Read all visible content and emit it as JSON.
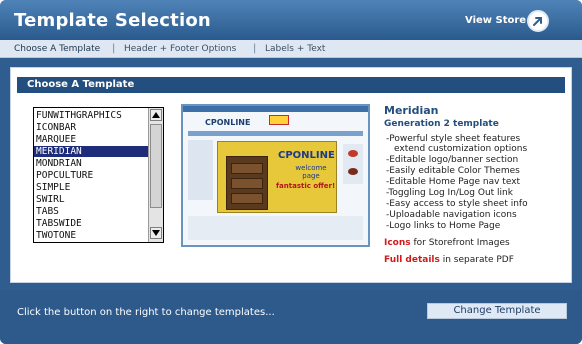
{
  "header": {
    "title": "Template Selection",
    "view_store_label": "View Store",
    "view_store_icon": "arrow-circle-icon"
  },
  "tabs": [
    {
      "label": "Choose A Template",
      "active": true
    },
    {
      "label": "Header + Footer Options",
      "active": false
    },
    {
      "label": "Labels + Text",
      "active": false
    }
  ],
  "tab_separator": "|",
  "section": {
    "title": "Choose A Template"
  },
  "template_list": {
    "items": [
      "FUNWITHGRAPHICS",
      "ICONBAR",
      "MARQUEE",
      "MERIDIAN",
      "MONDRIAN",
      "POPCULTURE",
      "SIMPLE",
      "SWIRL",
      "TABS",
      "TABSWIDE",
      "TWOTONE"
    ],
    "selected": "MERIDIAN"
  },
  "preview": {
    "logo_text": "CPONLINE",
    "hero_title": "CPONLINE",
    "hero_subtitle": "welcome page",
    "hero_callout": "fantastic offer!"
  },
  "details": {
    "name": "Meridian",
    "generation": "Generation 2 template",
    "features": [
      "-Powerful style sheet features",
      "  extend customization options",
      "-Editable logo/banner section",
      "-Easily editable Color Themes",
      "-Editable Home Page nav text",
      "-Toggling Log In/Log Out link",
      "-Easy access to style sheet info",
      "-Uploadable navigation icons",
      "-Logo links to Home Page"
    ],
    "icons_label": "Icons",
    "icons_text": " for Storefront Images",
    "full_details_label": "Full details",
    "full_details_text": " in separate PDF"
  },
  "footer": {
    "instruction": "Click the button on the right to change templates...",
    "change_button_label": "Change Template"
  },
  "colors": {
    "brand_blue": "#2f5d8f",
    "section_blue": "#234f80",
    "selected_row": "#1f2c7a",
    "highlight_red": "#d11b1b"
  }
}
